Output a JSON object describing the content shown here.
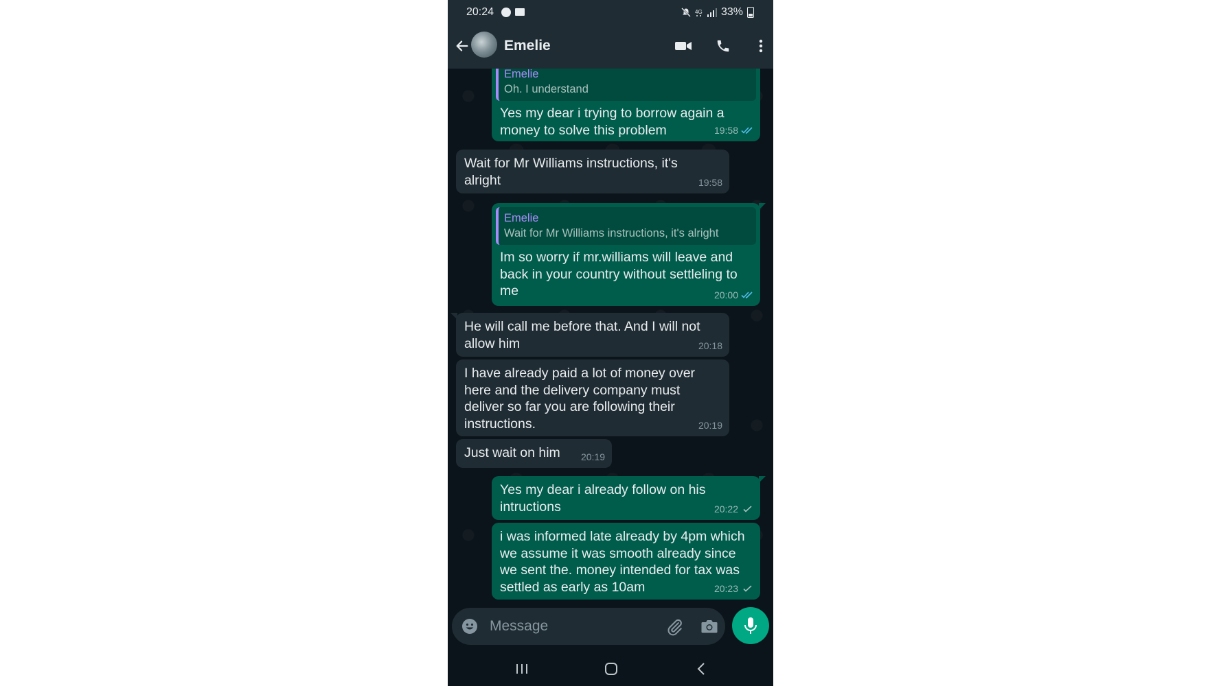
{
  "status_bar": {
    "time": "20:24",
    "battery": "33%",
    "left_icons": [
      "messenger-icon",
      "folder-icon"
    ],
    "right_icons": [
      "mute-icon",
      "4g-icon",
      "signal-icon",
      "battery-icon"
    ]
  },
  "header": {
    "contact_name": "Emelie",
    "actions": [
      "video-call-icon",
      "voice-call-icon",
      "more-options-icon"
    ]
  },
  "messages": [
    {
      "direction": "outgoing",
      "quote": {
        "name": "Emelie",
        "text": "Oh. I understand"
      },
      "text": "Yes my dear i trying to borrow again a money to solve this problem",
      "time": "19:58",
      "status": "read"
    },
    {
      "direction": "incoming",
      "text": "Wait for Mr Williams instructions, it's alright",
      "time": "19:58"
    },
    {
      "direction": "outgoing",
      "quote": {
        "name": "Emelie",
        "text": "Wait for Mr Williams instructions, it's alright"
      },
      "text": "Im so worry if mr.williams will leave and back in your country without settleling to me",
      "time": "20:00",
      "status": "read"
    },
    {
      "direction": "incoming",
      "text": "He will call me before that. And I will not allow him",
      "time": "20:18"
    },
    {
      "direction": "incoming",
      "text": "I have already paid a lot of money over here and the delivery company must deliver so far you are following their instructions.",
      "time": "20:19"
    },
    {
      "direction": "incoming",
      "text": "Just wait on him",
      "time": "20:19"
    },
    {
      "direction": "outgoing",
      "text": "Yes my dear i already follow on his intructions",
      "time": "20:22",
      "status": "sent"
    },
    {
      "direction": "outgoing",
      "text": "i was informed late already by 4pm which we assume it was smooth already since we sent the. money intended for tax was settled as early as 10am",
      "time": "20:23",
      "status": "sent"
    }
  ],
  "composer": {
    "placeholder": "Message"
  },
  "colors": {
    "outgoing_bubble": "#005c4b",
    "incoming_bubble": "#202c33",
    "chat_background": "#0b141a",
    "header_background": "#1f2c34",
    "accent": "#00a884",
    "quote_accent": "#a78bfa",
    "read_tick": "#53bdeb"
  }
}
